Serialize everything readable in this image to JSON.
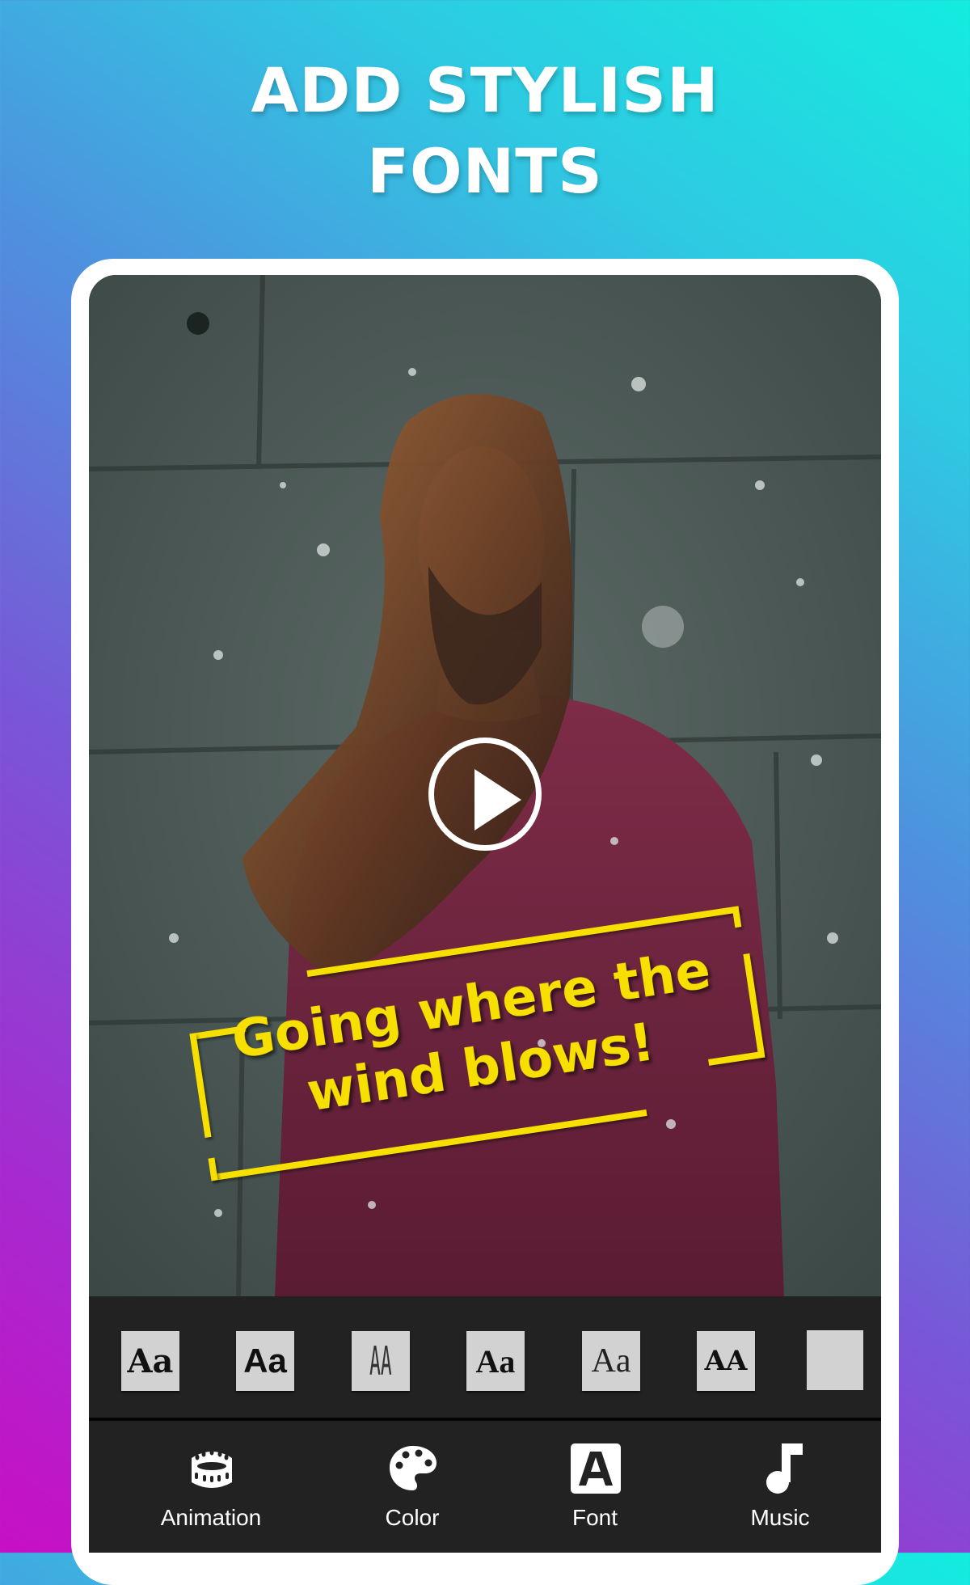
{
  "headline": {
    "line1": "ADD STYLISH",
    "line2": "FONTS"
  },
  "preview": {
    "play_icon": "play-circle-icon",
    "caption_line1": "Going where the",
    "caption_line2": "wind blows!",
    "caption_color": "#f7e000"
  },
  "font_options": [
    {
      "sample": "Aa",
      "style": "serif-bold-contrast"
    },
    {
      "sample": "Aa",
      "style": "sans-bold"
    },
    {
      "sample": "AA",
      "style": "condensed-thin"
    },
    {
      "sample": "Aa",
      "style": "serif-bold"
    },
    {
      "sample": "Aa",
      "style": "serif-light"
    },
    {
      "sample": "AA",
      "style": "serif-caps"
    },
    {
      "sample": "",
      "style": "blank"
    }
  ],
  "bottom_nav": [
    {
      "label": "Animation",
      "icon": "film-reel-icon"
    },
    {
      "label": "Color",
      "icon": "palette-icon"
    },
    {
      "label": "Font",
      "icon": "font-a-icon"
    },
    {
      "label": "Music",
      "icon": "music-note-icon"
    }
  ],
  "colors": {
    "gradient_top_right": "#14ecdf",
    "gradient_bottom_left": "#c80fc4",
    "toolbar_bg": "#222222",
    "thumb_bg": "#d2d2d2"
  }
}
